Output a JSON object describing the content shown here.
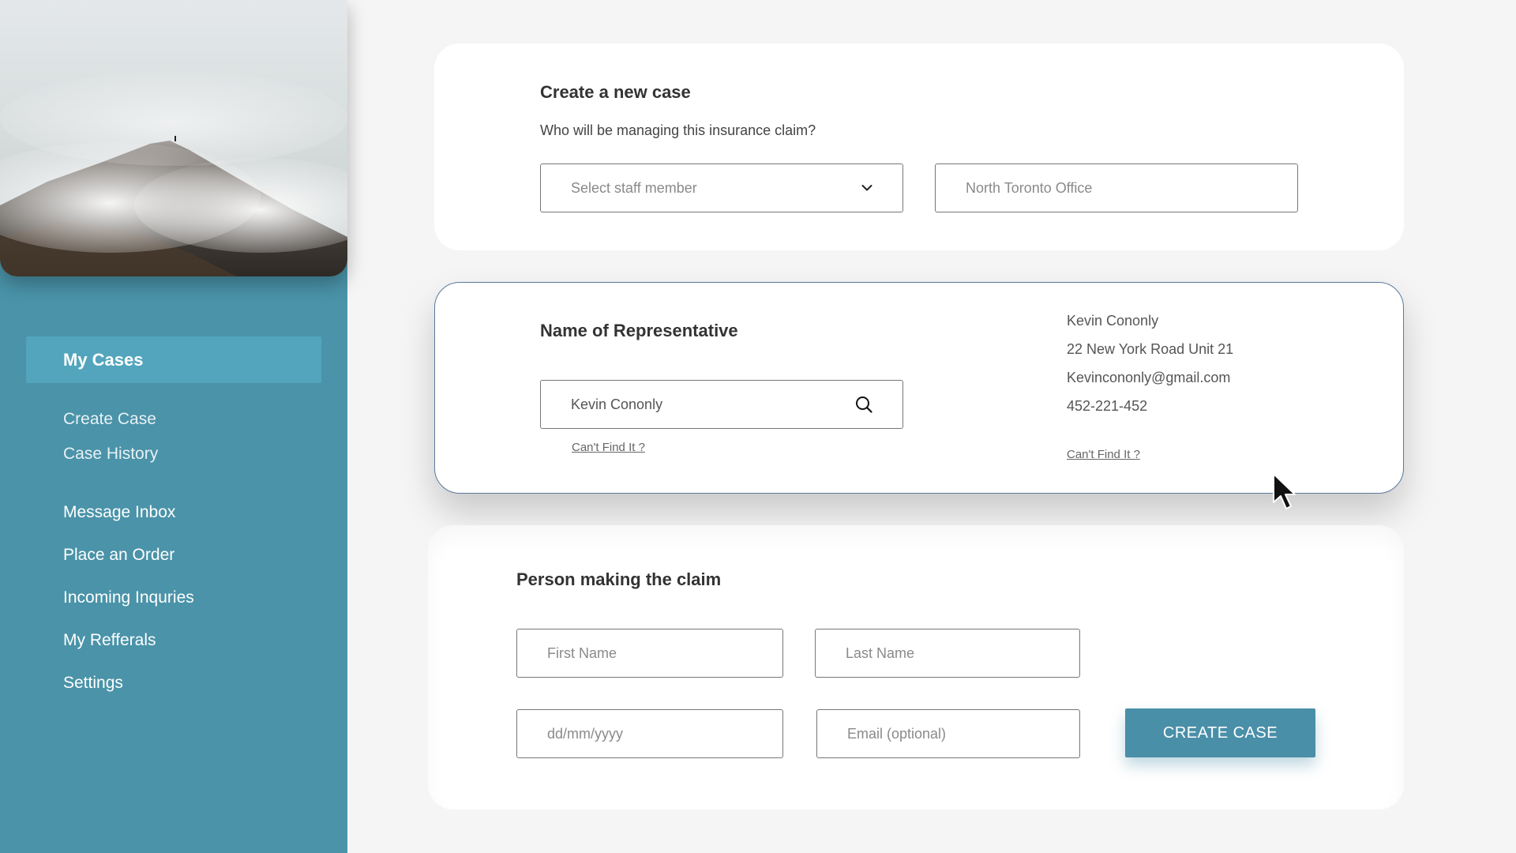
{
  "sidebar": {
    "active_item": "My Cases",
    "sub_items": [
      "Create Case",
      "Case History"
    ],
    "items": [
      "Message Inbox",
      "Place an Order",
      "Incoming Inquries",
      "My Refferals",
      "Settings"
    ]
  },
  "create_case": {
    "title": "Create a new case",
    "question": "Who will be managing this insurance claim?",
    "staff_select_placeholder": "Select staff member",
    "office_value": "North Toronto Office"
  },
  "representative": {
    "title": "Name of Representative",
    "search_value": "Kevin Cononly",
    "cant_find_label": "Can't Find It ?",
    "details": {
      "name": "Kevin Cononly",
      "address": "22 New York Road Unit 21",
      "email": "Kevinconon­ly@gmail.com",
      "phone": "452-221-452"
    },
    "details_cant_find_label": "Can't Find It ?"
  },
  "claimant": {
    "title": "Person making the claim",
    "first_name_placeholder": "First Name",
    "last_name_placeholder": "Last Name",
    "dob_placeholder": "dd/mm/yyyy",
    "email_placeholder": "Email (optional)",
    "submit_label": "CREATE CASE"
  },
  "colors": {
    "sidebar": "#4a93a9",
    "sidebar_active": "#52a5bd",
    "button": "#4a8fa8",
    "card_border": "#5b7a9a"
  },
  "icons": {
    "dropdown": "chevron-down-icon",
    "search": "search-icon",
    "cursor": "mouse-pointer-icon"
  }
}
